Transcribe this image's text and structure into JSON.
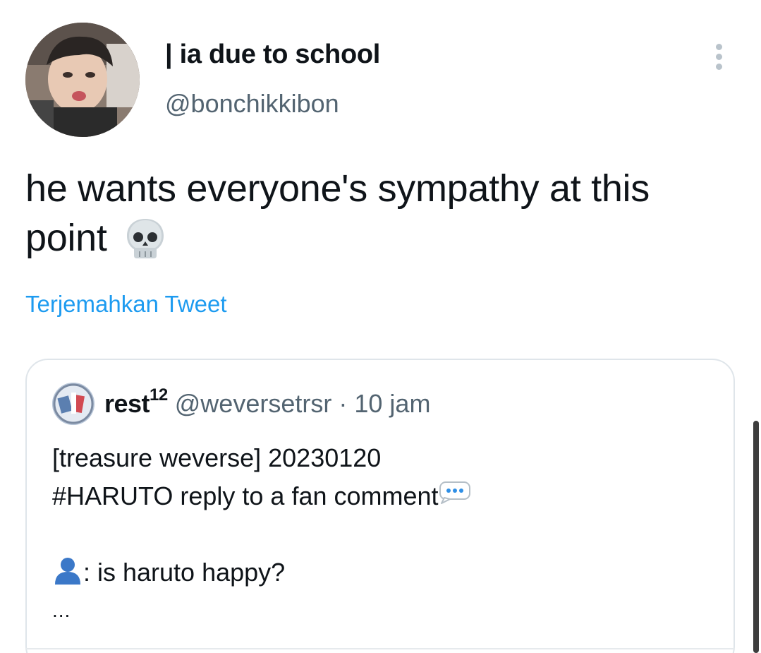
{
  "tweet": {
    "display_name": "| ia due to school",
    "handle": "@bonchikkibon",
    "text": "he wants everyone's sympathy at this point",
    "text_emoji": "skull-emoji",
    "translate_label": "Terjemahkan Tweet",
    "more_icon": "more-options-icon"
  },
  "quote": {
    "name": "rest",
    "name_superscript": "12",
    "handle": "@weversetrsr",
    "separator": "·",
    "time": "10 jam",
    "lines": [
      "[treasure weverse] 20230120",
      "#HARUTO reply to a fan comment",
      "",
      ": is haruto happy?",
      "..."
    ],
    "line_icons": [
      "",
      "speech-bubble-emoji",
      "",
      "bust-silhouette-emoji",
      ""
    ]
  },
  "colors": {
    "text": "#0f1419",
    "secondary": "#536471",
    "link": "#1d9bf0",
    "border": "#dfe5ea"
  }
}
